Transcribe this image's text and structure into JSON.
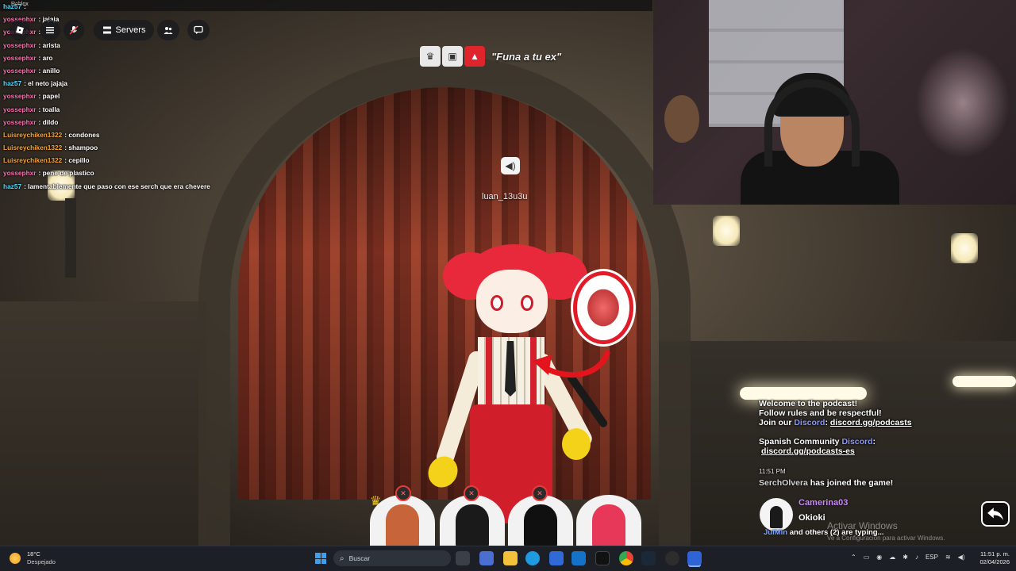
{
  "window": {
    "title": "Roblox"
  },
  "topbar": {
    "servers_label": "Servers"
  },
  "chat": [
    {
      "user": "haz57",
      "msg": "",
      "color": "#4cd9ff"
    },
    {
      "user": "yossephxr",
      "msg": "jajaja",
      "color": "#ff6fb2"
    },
    {
      "user": "yossephxr",
      "msg": "",
      "color": "#ff6fb2"
    },
    {
      "user": "yossephxr",
      "msg": "arista",
      "color": "#ff6fb2"
    },
    {
      "user": "yossephxr",
      "msg": "aro",
      "color": "#ff6fb2"
    },
    {
      "user": "yossephxr",
      "msg": "anillo",
      "color": "#ff6fb2"
    },
    {
      "user": "haz57",
      "msg": "el neto jajaja",
      "color": "#4cd9ff"
    },
    {
      "user": "yossephxr",
      "msg": "papel",
      "color": "#ff6fb2"
    },
    {
      "user": "yossephxr",
      "msg": "toalla",
      "color": "#ff6fb2"
    },
    {
      "user": "yossephxr",
      "msg": "dildo",
      "color": "#ff6fb2"
    },
    {
      "user": "Luisreychiken1322",
      "msg": "condones",
      "color": "#f7a531"
    },
    {
      "user": "Luisreychiken1322",
      "msg": "shampoo",
      "color": "#f7a531"
    },
    {
      "user": "Luisreychiken1322",
      "msg": "cepillo",
      "color": "#f7a531"
    },
    {
      "user": "yossephxr",
      "msg": "pene de plastico",
      "color": "#ff6fb2"
    },
    {
      "user": "haz57",
      "msg": "lamentablemente que paso con ese serch que era chevere",
      "color": "#4cd9ff"
    }
  ],
  "topic": {
    "quote": "\"Funa a tu ex\""
  },
  "speaker": {
    "name": "luan_13u3u"
  },
  "system_chat": {
    "line1": "Welcome to the podcast!",
    "line2": "Follow rules and be respectful!",
    "join_prefix": "Join our ",
    "discord_word": "Discord",
    "colon": ": ",
    "discord_link": "discord.gg/podcasts",
    "spanish_prefix": "Spanish Community ",
    "spanish_colon": ":",
    "spanish_link": "discord.gg/podcasts-es",
    "time": "11:51 PM",
    "joined_name": "SerchOlvera",
    "joined_text": " has joined the game!"
  },
  "message": {
    "name": "Camerina03",
    "text": "Okioki"
  },
  "typing": {
    "user": "JulMin",
    "text": " and others (2) are typing..."
  },
  "watermark": {
    "title": "Activar Windows",
    "subtitle": "Ve a Configuración para activar Windows."
  },
  "taskbar": {
    "weather_temp": "18°C",
    "weather_desc": "Despejado",
    "search_placeholder": "Buscar",
    "lang": "ESP",
    "time": "11:51 p. m.",
    "date": "02/04/2026"
  },
  "colors": {
    "accent_red": "#e0242c",
    "discord": "#8c96ff",
    "msg_name": "#c989f5"
  }
}
